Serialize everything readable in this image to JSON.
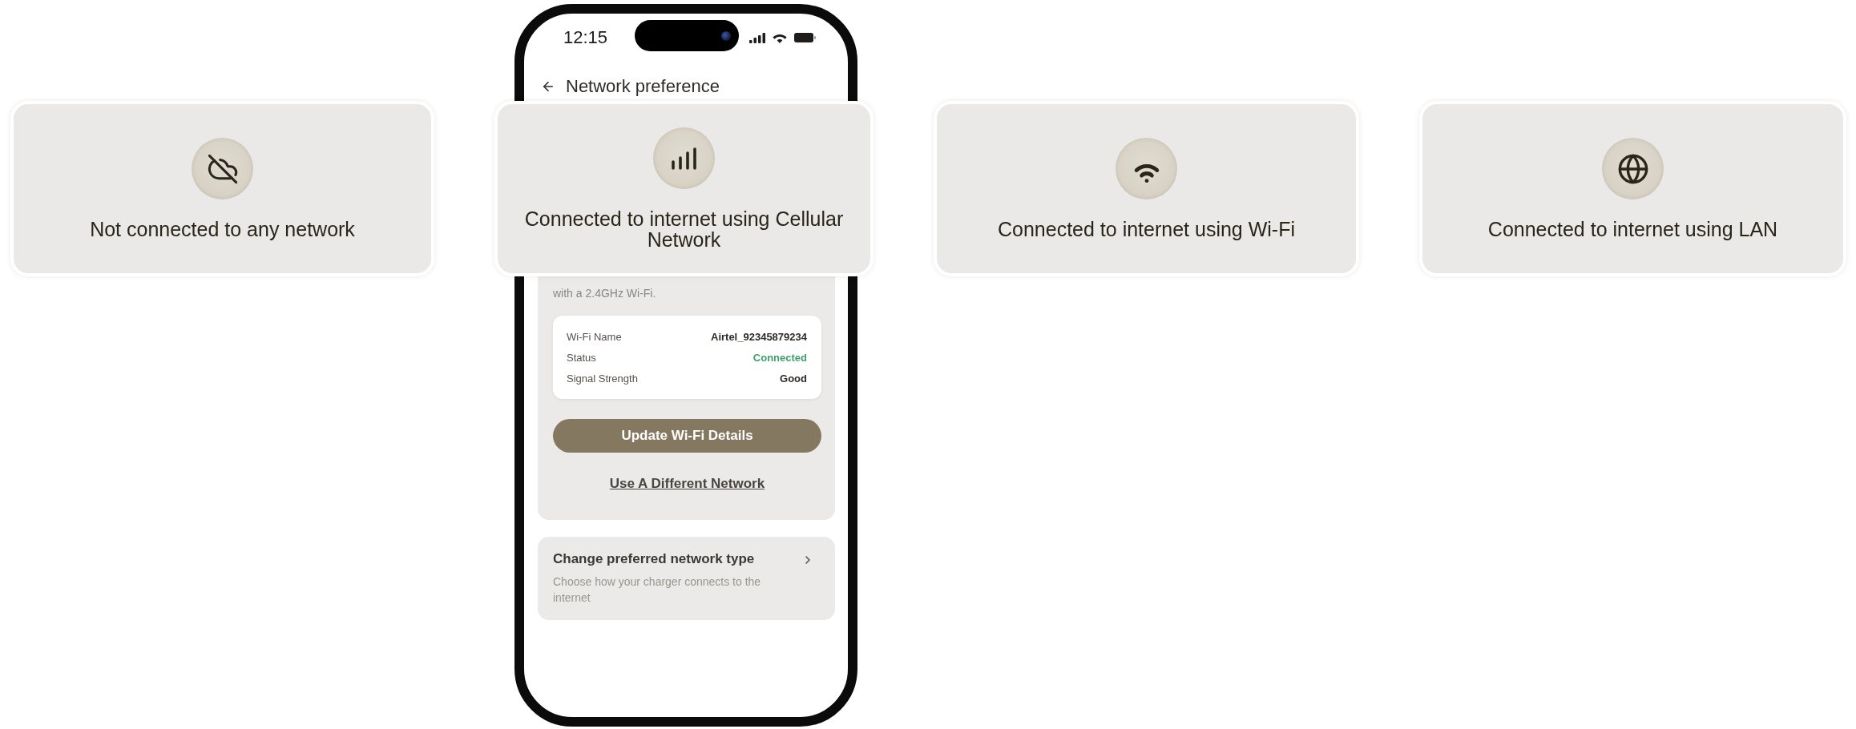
{
  "phone": {
    "status_bar": {
      "time": "12:15"
    },
    "header": {
      "title": "Network preference"
    },
    "wifi_panel": {
      "note": "with a 2.4GHz Wi-Fi.",
      "details": [
        {
          "label": "Wi-Fi Name",
          "value": "Airtel_92345879234",
          "kind": "text"
        },
        {
          "label": "Status",
          "value": "Connected",
          "kind": "status"
        },
        {
          "label": "Signal Strength",
          "value": "Good",
          "kind": "text"
        }
      ],
      "button": "Update Wi-Fi Details",
      "link": "Use A Different Network"
    },
    "network_type": {
      "title": "Change preferred network type",
      "subtitle": "Choose how your charger connects to the internet"
    }
  },
  "states": [
    {
      "kind": "offline",
      "caption": "Not connected to any network"
    },
    {
      "kind": "cellular",
      "caption": "Connected to internet using Cellular Network"
    },
    {
      "kind": "wifi",
      "caption": "Connected to internet using Wi-Fi"
    },
    {
      "kind": "lan",
      "caption": "Connected to internet using LAN"
    }
  ]
}
